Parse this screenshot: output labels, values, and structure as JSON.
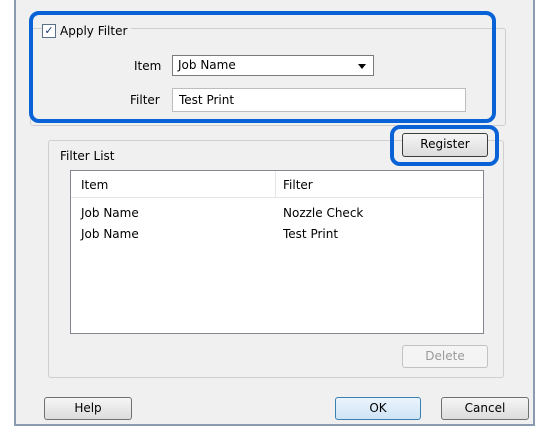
{
  "filter_group": {
    "apply_filter_label": "Apply Filter",
    "apply_filter_checked": true,
    "item_label": "Item",
    "item_value": "Job Name",
    "filter_label": "Filter",
    "filter_value": "Test Print"
  },
  "register_label": "Register",
  "filter_list": {
    "title": "Filter List",
    "columns": [
      "Item",
      "Filter"
    ],
    "rows": [
      {
        "item": "Job Name",
        "filter": "Nozzle Check"
      },
      {
        "item": "Job Name",
        "filter": "Test Print"
      }
    ],
    "delete_label": "Delete"
  },
  "footer": {
    "help_label": "Help",
    "ok_label": "OK",
    "cancel_label": "Cancel"
  },
  "colors": {
    "highlight": "#0a63d6",
    "dialog_bg": "#f0f0f0"
  },
  "icons": {
    "checkbox": "check-mark",
    "dropdown": "triangle-down"
  }
}
